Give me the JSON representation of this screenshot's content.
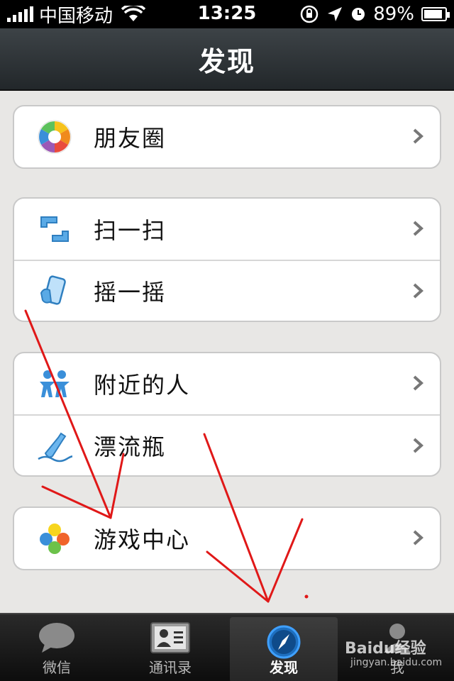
{
  "status_bar": {
    "carrier": "中国移动",
    "time": "13:25",
    "battery_text": "89%",
    "battery_level": 0.89
  },
  "nav": {
    "title": "发现"
  },
  "groups": [
    [
      {
        "label": "朋友圈",
        "icon": "moments-icon"
      }
    ],
    [
      {
        "label": "扫一扫",
        "icon": "scan-icon"
      },
      {
        "label": "摇一摇",
        "icon": "shake-icon"
      }
    ],
    [
      {
        "label": "附近的人",
        "icon": "people-nearby-icon"
      },
      {
        "label": "漂流瓶",
        "icon": "drift-bottle-icon"
      }
    ],
    [
      {
        "label": "游戏中心",
        "icon": "game-center-icon"
      }
    ]
  ],
  "tabs": [
    {
      "label": "微信",
      "icon": "chat-bubble-icon",
      "active": false
    },
    {
      "label": "通讯录",
      "icon": "contacts-icon",
      "active": false
    },
    {
      "label": "发现",
      "icon": "compass-icon",
      "active": true
    },
    {
      "label": "我",
      "icon": "me-icon",
      "active": false
    }
  ],
  "watermark": {
    "brand": "Baidu经验",
    "url": "jingyan.baidu.com"
  },
  "colors": {
    "annotation_red": "#e01818",
    "nav_bg": "#2b3033",
    "page_bg": "#e8e7e5"
  }
}
